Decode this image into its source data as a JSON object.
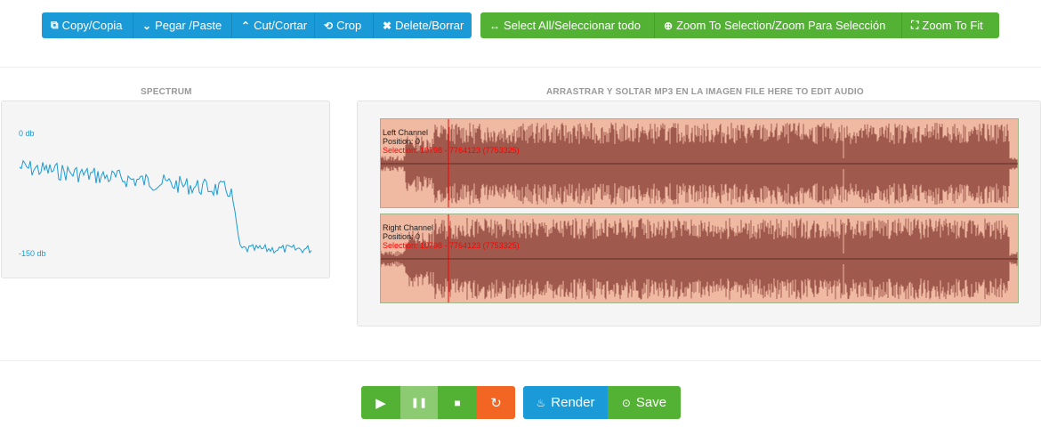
{
  "toolbar": {
    "edit_buttons": [
      {
        "label": "Copy/Copia",
        "icon": "external-link-icon",
        "glyph": "⧉"
      },
      {
        "label": "Pegar /Paste",
        "icon": "chevron-down-icon",
        "glyph": "⌄"
      },
      {
        "label": "Cut/Cortar",
        "icon": "chevron-up-icon",
        "glyph": "⌃"
      },
      {
        "label": "Crop",
        "icon": "crop-icon",
        "glyph": "⟲"
      },
      {
        "label": "Delete/Borrar",
        "icon": "close-icon",
        "glyph": "✖"
      }
    ],
    "view_buttons": [
      {
        "label": "Select All/Seleccionar todo",
        "icon": "arrows-horizontal-icon",
        "glyph": "↔"
      },
      {
        "label": "Zoom To Selection/Zoom Para Selección",
        "icon": "plus-circle-icon",
        "glyph": "⊕"
      },
      {
        "label": "Zoom To Fit",
        "icon": "fit-screen-icon",
        "glyph": "⛶"
      }
    ]
  },
  "spectrum": {
    "title": "SPECTRUM",
    "top_label": "0 db",
    "bottom_label": "-150 db"
  },
  "editor": {
    "title": "ARRASTRAR Y SOLTAR MP3 EN LA IMAGEN FILE HERE TO EDIT AUDIO",
    "channels": [
      {
        "name": "Left Channel",
        "position": "Position: 0",
        "selection": "Selection: 10798 - 7764123 (7753325)"
      },
      {
        "name": "Right Channel",
        "position": "Position: 0",
        "selection": "Selection: 10798 - 7764123 (7753325)"
      }
    ]
  },
  "playback": {
    "play_icon": "play-icon",
    "pause_icon": "pause-icon",
    "stop_icon": "stop-icon",
    "loop_icon": "refresh-icon",
    "render_label": "Render",
    "save_label": "Save"
  },
  "colors": {
    "blue": "#1a9bd7",
    "green": "#53b234",
    "orange": "#f26522",
    "waveform": "#a0594d",
    "waveform_bg": "#efb9a2"
  }
}
